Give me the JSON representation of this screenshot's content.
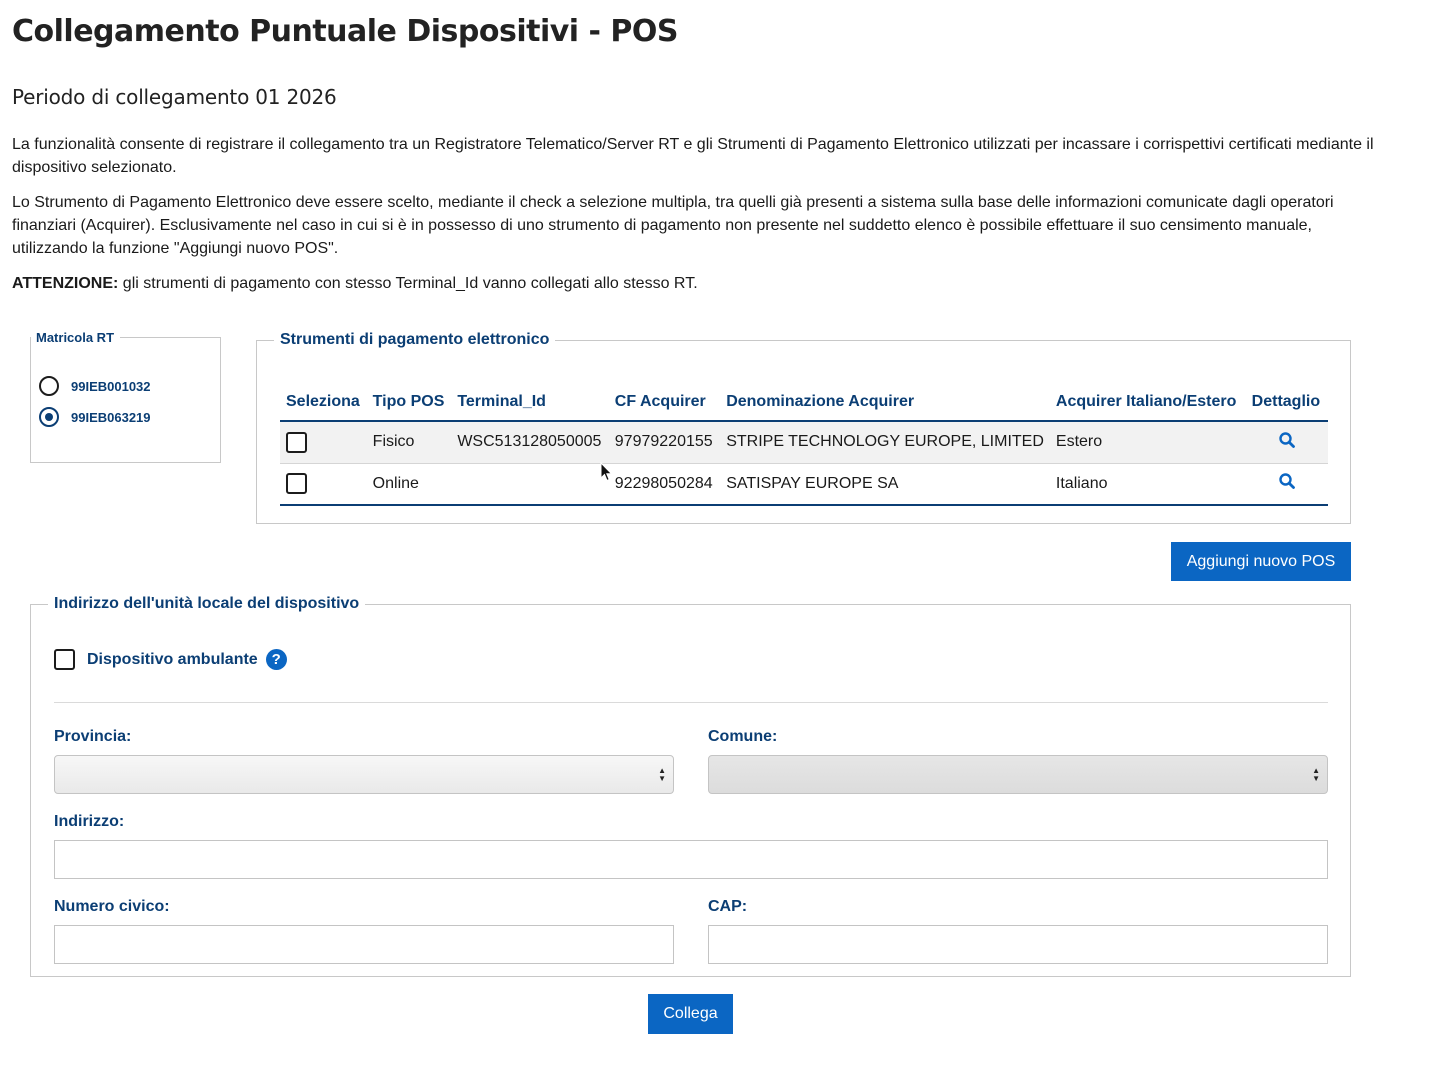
{
  "page": {
    "title": "Collegamento Puntuale Dispositivi - POS",
    "period": "Periodo di collegamento 01 2026",
    "desc1": "La funzionalità consente di registrare il collegamento tra un Registratore Telematico/Server RT e gli Strumenti di Pagamento Elettronico utilizzati per incassare i corrispettivi certificati mediante il dispositivo selezionato.",
    "desc2": "Lo Strumento di Pagamento Elettronico deve essere scelto, mediante il check a selezione multipla, tra quelli già presenti a sistema sulla base delle informazioni comunicate dagli operatori finanziari (Acquirer). Esclusivamente nel caso in cui si è in possesso di uno strumento di pagamento non presente nel suddetto elenco è possibile effettuare il suo censimento manuale, utilizzando la funzione \"Aggiungi nuovo POS\".",
    "attention_label": "ATTENZIONE:",
    "attention_text": " gli strumenti di pagamento con stesso Terminal_Id vanno collegati allo stesso RT."
  },
  "matricola": {
    "legend": "Matricola RT",
    "options": [
      {
        "label": "99IEB001032",
        "selected": false
      },
      {
        "label": "99IEB063219",
        "selected": true
      }
    ]
  },
  "strumenti": {
    "legend": "Strumenti di pagamento elettronico",
    "columns": [
      "Seleziona",
      "Tipo POS",
      "Terminal_Id",
      "CF Acquirer",
      "Denominazione Acquirer",
      "Acquirer Italiano/Estero",
      "Dettaglio"
    ],
    "rows": [
      {
        "tipo": "Fisico",
        "terminal": "WSC513128050005",
        "cf": "97979220155",
        "denominazione": "STRIPE TECHNOLOGY EUROPE, LIMITED",
        "origine": "Estero",
        "checked": false
      },
      {
        "tipo": "Online",
        "terminal": "",
        "cf": "92298050284",
        "denominazione": "SATISPAY EUROPE SA",
        "origine": "Italiano",
        "checked": false
      }
    ]
  },
  "buttons": {
    "add_pos": "Aggiungi nuovo POS",
    "collega": "Collega"
  },
  "indirizzo": {
    "legend": "Indirizzo dell'unità locale del dispositivo",
    "ambulante_label": "Dispositivo ambulante",
    "help": "?",
    "provincia_label": "Provincia:",
    "comune_label": "Comune:",
    "indirizzo_label": "Indirizzo:",
    "civico_label": "Numero civico:",
    "cap_label": "CAP:",
    "provincia_value": "",
    "comune_value": "",
    "indirizzo_value": "",
    "civico_value": "",
    "cap_value": ""
  },
  "colors": {
    "label_blue": "#0b3e74",
    "button_blue": "#0b66c3"
  }
}
